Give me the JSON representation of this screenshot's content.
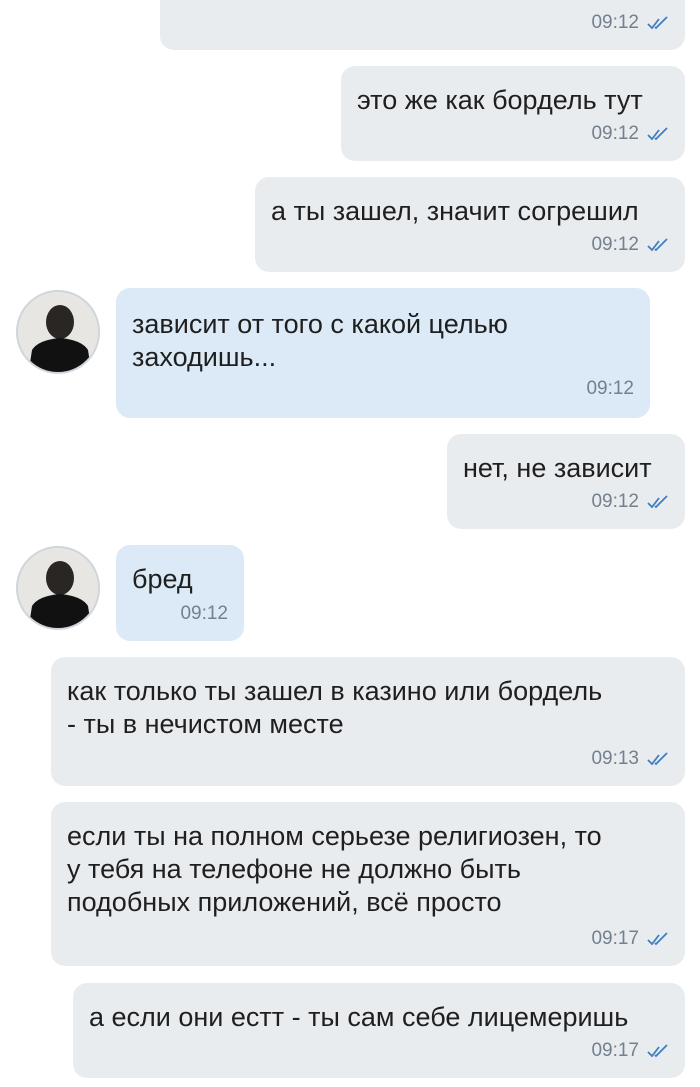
{
  "messages": [
    {
      "id": "m1",
      "text": "",
      "time": "09:12",
      "read": true
    },
    {
      "id": "m2",
      "text": "это же как бордель тут",
      "time": "09:12",
      "read": true
    },
    {
      "id": "m3",
      "text": "а ты зашел, значит согрешил",
      "time": "09:12",
      "read": true
    },
    {
      "id": "m4",
      "lines": [
        "зависит от того с какой целью",
        "заходишь..."
      ],
      "time": "09:12"
    },
    {
      "id": "m5",
      "text": "нет, не зависит",
      "time": "09:12",
      "read": true
    },
    {
      "id": "m6",
      "text": "бред",
      "time": "09:12"
    },
    {
      "id": "m7",
      "lines": [
        "как только ты зашел в казино или бордель",
        "- ты в нечистом месте"
      ],
      "time": "09:13",
      "read": true
    },
    {
      "id": "m8",
      "lines": [
        "если ты на полном серьезе религиозен, то",
        "у тебя на телефоне не должно быть",
        "подобных приложений, всё просто"
      ],
      "time": "09:17",
      "read": true
    },
    {
      "id": "m9",
      "text": "а если они естт - ты сам себе лицемеришь",
      "time": "09:17",
      "read": true
    }
  ],
  "colors": {
    "outgoing_bubble": "#e9ecef",
    "incoming_bubble": "#dceaf7",
    "timestamp": "#72808f",
    "read_check": "#3f7fc0"
  },
  "icons": {
    "read_receipt": "double-check-icon",
    "avatar": "contact-avatar"
  }
}
